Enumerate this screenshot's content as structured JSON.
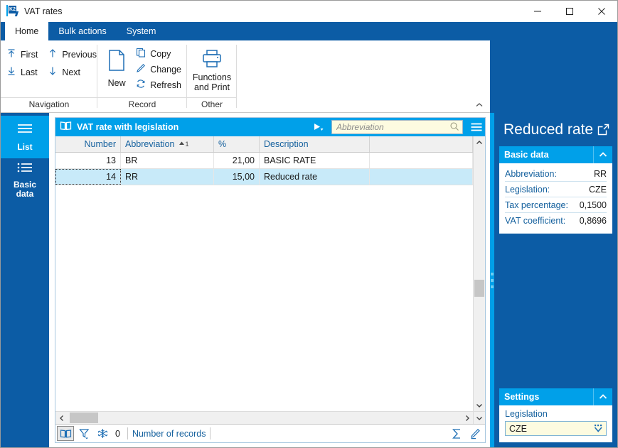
{
  "window": {
    "title": "VAT rates",
    "app_icon": "k2-logo-icon",
    "minimize": "minimize-icon",
    "maximize": "maximize-icon",
    "close": "close-icon"
  },
  "ribbon": {
    "tabs": [
      {
        "label": "Home",
        "active": true
      },
      {
        "label": "Bulk actions",
        "active": false
      },
      {
        "label": "System",
        "active": false
      }
    ],
    "groups": [
      {
        "name": "Navigation",
        "label": "Navigation",
        "items": [
          {
            "label": "First",
            "icon": "arrow-up-to-line-icon"
          },
          {
            "label": "Previous",
            "icon": "arrow-up-icon"
          },
          {
            "label": "Last",
            "icon": "arrow-down-to-line-icon"
          },
          {
            "label": "Next",
            "icon": "arrow-down-icon"
          }
        ]
      },
      {
        "name": "Record",
        "label": "Record",
        "items": [
          {
            "label": "New",
            "icon": "new-document-icon"
          },
          {
            "label": "Copy",
            "icon": "copy-icon"
          },
          {
            "label": "Change",
            "icon": "pencil-icon"
          },
          {
            "label": "Refresh",
            "icon": "refresh-icon"
          }
        ]
      },
      {
        "name": "Other",
        "label": "Other",
        "items": [
          {
            "label": "Functions\nand Print",
            "label_line1": "Functions",
            "label_line2": "and Print",
            "icon": "printer-icon"
          }
        ]
      }
    ],
    "collapse_icon": "chevron-up-icon"
  },
  "sidebar": {
    "items": [
      {
        "label": "List",
        "icon": "list-lines-icon",
        "selected": true
      },
      {
        "label_line1": "Basic",
        "label_line2": "data",
        "icon": "bullet-list-icon",
        "selected": false
      }
    ]
  },
  "grid": {
    "title": "VAT rate with legislation",
    "title_icon": "book-icon",
    "play_icon": "play-dropdown-icon",
    "menu_icon": "hamburger-menu-icon",
    "search": {
      "placeholder": "Abbreviation",
      "value": "",
      "icon": "search-icon"
    },
    "columns": [
      {
        "label": "Number",
        "align": "right",
        "sort": null
      },
      {
        "label": "Abbreviation",
        "align": "left",
        "sort": "asc",
        "sort_index": "1"
      },
      {
        "label": "%",
        "align": "left",
        "sort": null
      },
      {
        "label": "Description",
        "align": "left",
        "sort": null
      },
      {
        "label": "",
        "align": "left",
        "sort": null
      }
    ],
    "rows": [
      {
        "number": "13",
        "abbreviation": "BR",
        "percent": "21,00",
        "description": "BASIC RATE",
        "extra": "",
        "selected": false
      },
      {
        "number": "14",
        "abbreviation": "RR",
        "percent": "15,00",
        "description": "Reduced rate",
        "extra": "",
        "selected": true
      }
    ]
  },
  "statusbar": {
    "book_icon": "book-view-icon",
    "filter_icon": "filter-icon",
    "freeze_icon": "snowflake-icon",
    "count": "0",
    "records_label": "Number of records",
    "sum_icon": "sigma-icon",
    "edit_icon": "pencil-edit-icon"
  },
  "right_panel": {
    "title": "Reduced rate",
    "popout_icon": "open-external-icon",
    "basic_data": {
      "header": "Basic data",
      "chevron_icon": "chevron-up-icon",
      "fields": [
        {
          "label": "Abbreviation:",
          "value": "RR"
        },
        {
          "label": "Legislation:",
          "value": "CZE"
        },
        {
          "label": "Tax percentage:",
          "value": "0,1500"
        },
        {
          "label": "VAT coefficient:",
          "value": "0,8696"
        }
      ]
    },
    "settings": {
      "header": "Settings",
      "chevron_icon": "chevron-up-icon",
      "field_label": "Legislation",
      "field_value": "CZE",
      "dropdown_icon": "combo-dropdown-icon"
    }
  },
  "colors": {
    "ribbon_blue": "#0c5ca5",
    "accent_cyan": "#00a0e9",
    "selection_blue": "#c8eaf9",
    "field_yellow": "#fdfbe0",
    "link_blue": "#15619e"
  }
}
